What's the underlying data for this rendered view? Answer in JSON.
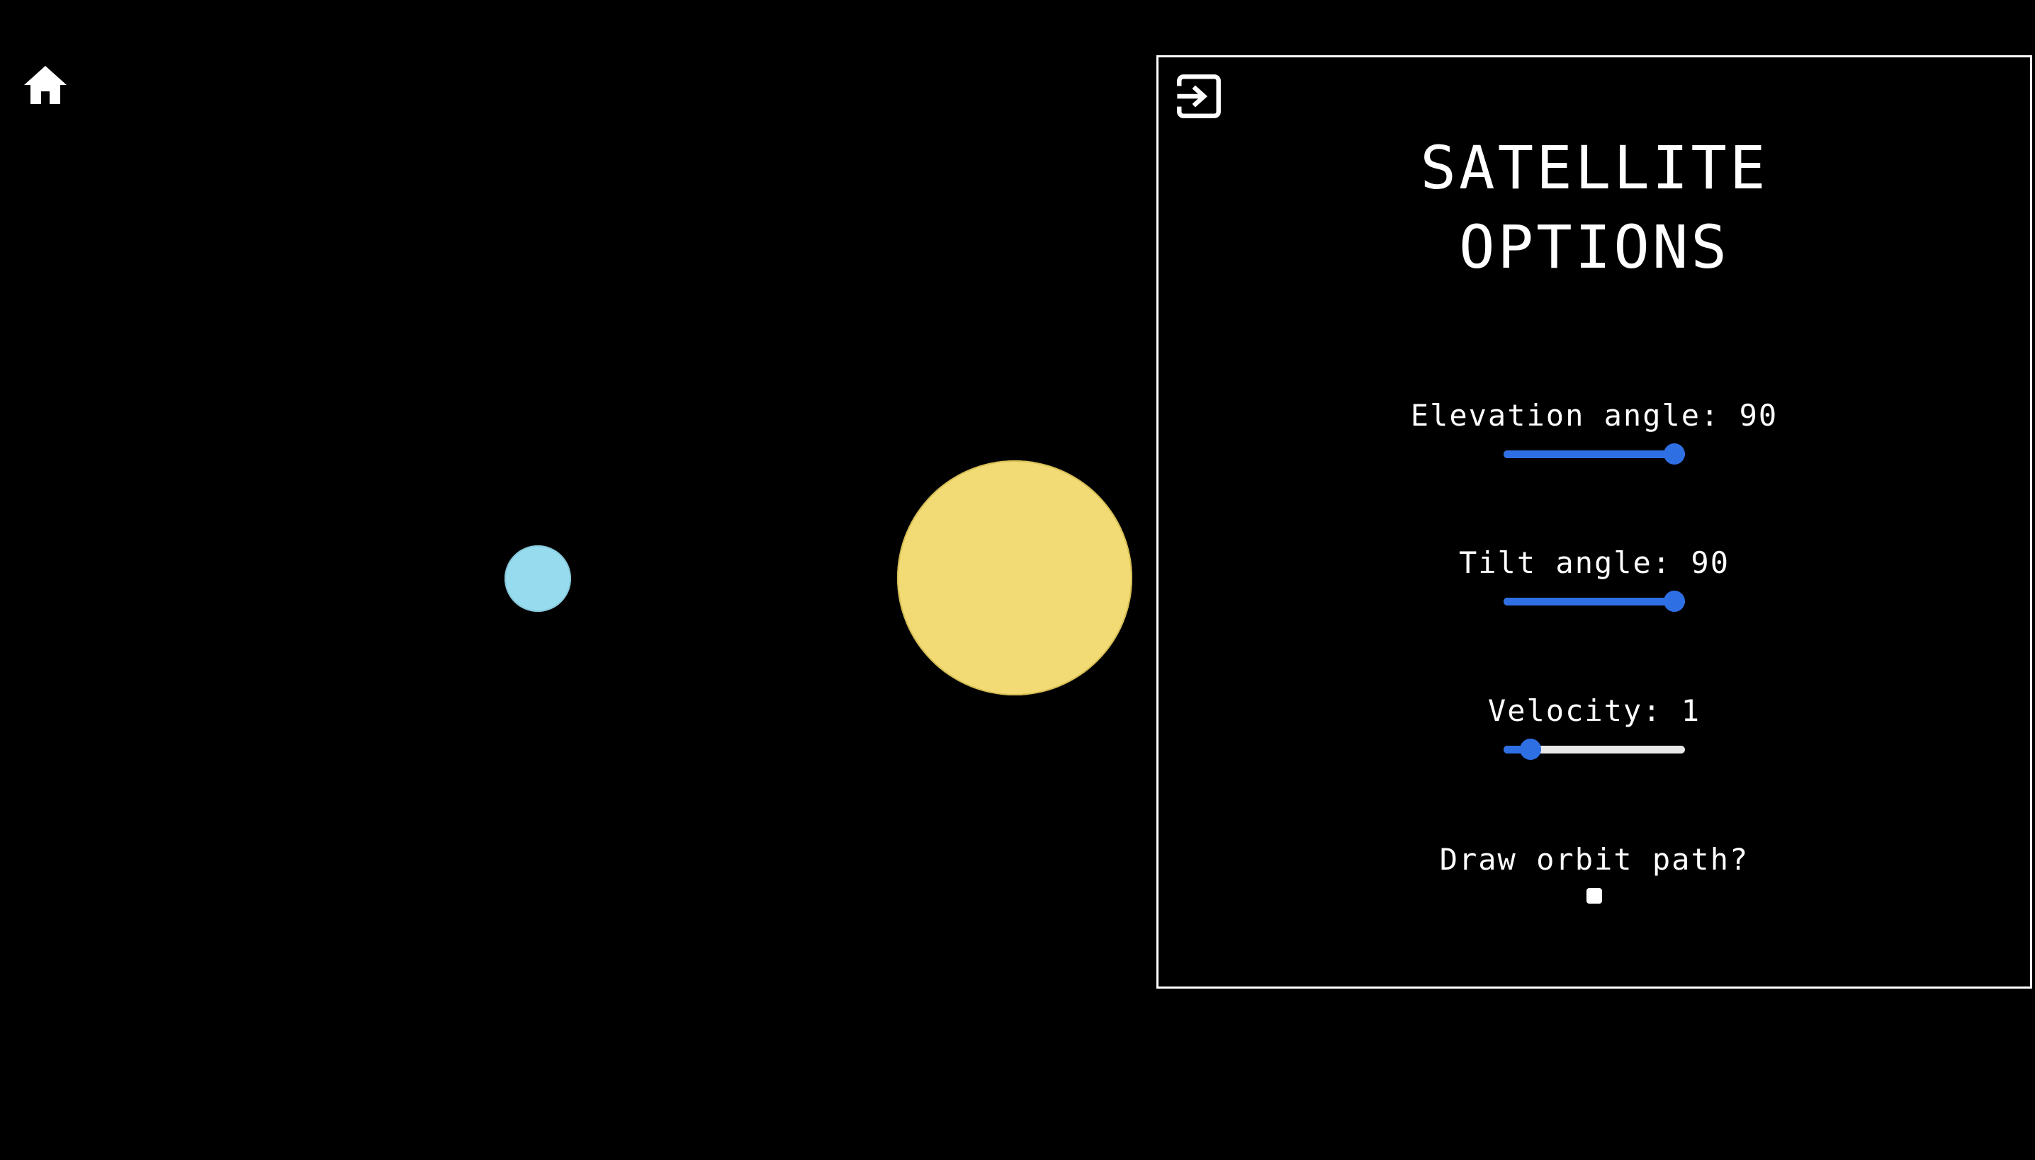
{
  "nav": {
    "home_icon": "home-icon"
  },
  "scene": {
    "satellite_color": "#97dcee",
    "sun_color": "#f2da74",
    "background": "#000000"
  },
  "panel": {
    "collapse_icon": "exit-panel-icon",
    "title_line1": "SATELLITE",
    "title_line2": "OPTIONS",
    "accent_color": "#2f6fe4",
    "elevation": {
      "label": "Elevation angle: 90",
      "value": 90,
      "min": 0,
      "max": 90
    },
    "tilt": {
      "label": "Tilt angle: 90",
      "value": 90,
      "min": 0,
      "max": 90
    },
    "velocity": {
      "label": "Velocity: 1",
      "value": 1,
      "min": 0,
      "max": 10
    },
    "orbit_path": {
      "label": "Draw orbit path?",
      "checked": false
    }
  }
}
